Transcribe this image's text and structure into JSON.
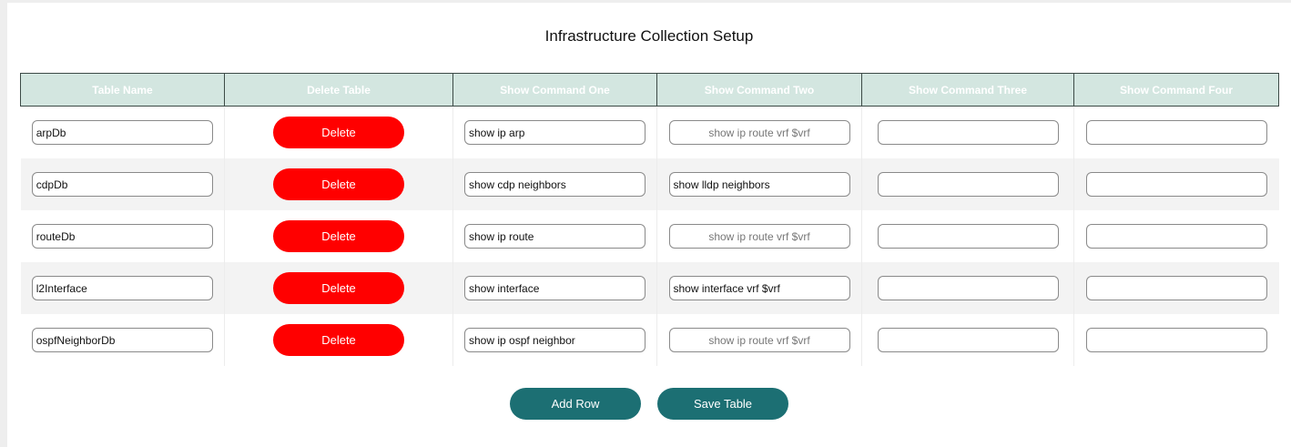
{
  "page": {
    "title": "Infrastructure Collection Setup"
  },
  "table": {
    "headers": [
      "Table Name",
      "Delete Table",
      "Show Command One",
      "Show Command Two",
      "Show Command Three",
      "Show Command Four"
    ],
    "delete_label": "Delete",
    "rows": [
      {
        "table_name": "arpDb",
        "cmd1": "show ip arp",
        "cmd2": "",
        "cmd2_placeholder": "show ip route vrf $vrf",
        "cmd3": "",
        "cmd4": ""
      },
      {
        "table_name": "cdpDb",
        "cmd1": "show cdp neighbors",
        "cmd2": "show lldp neighbors",
        "cmd2_placeholder": "",
        "cmd3": "",
        "cmd4": ""
      },
      {
        "table_name": "routeDb",
        "cmd1": "show ip route",
        "cmd2": "",
        "cmd2_placeholder": "show ip route vrf $vrf",
        "cmd3": "",
        "cmd4": ""
      },
      {
        "table_name": "l2Interface",
        "cmd1": "show interface",
        "cmd2": "show interface vrf $vrf",
        "cmd2_placeholder": "",
        "cmd3": "",
        "cmd4": ""
      },
      {
        "table_name": "ospfNeighborDb",
        "cmd1": "show ip ospf neighbor",
        "cmd2": "",
        "cmd2_placeholder": "show ip route vrf $vrf",
        "cmd3": "",
        "cmd4": ""
      }
    ]
  },
  "actions": {
    "add_row_label": "Add Row",
    "save_table_label": "Save Table"
  },
  "colors": {
    "header_bg": "#d3e6e0",
    "delete_button": "#ff0000",
    "primary_button": "#1c6f73"
  }
}
